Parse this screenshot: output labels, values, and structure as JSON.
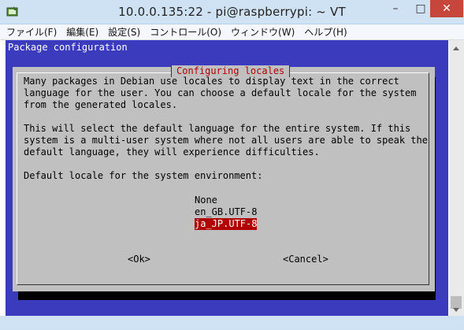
{
  "window": {
    "title": "10.0.0.135:22 - pi@raspberrypi: ~ VT",
    "minimize_icon": "minimize-icon",
    "maximize_icon": "maximize-icon",
    "close_icon": "close-icon"
  },
  "menu": {
    "items": [
      {
        "label": "ファイル(F)"
      },
      {
        "label": "編集(E)"
      },
      {
        "label": "設定(S)"
      },
      {
        "label": "コントロール(O)"
      },
      {
        "label": "ウィンドウ(W)"
      },
      {
        "label": "ヘルプ(H)"
      }
    ]
  },
  "terminal": {
    "header": "Package configuration",
    "dialog": {
      "title": "Configuring locales",
      "description": "Many packages in Debian use locales to display text in the correct\nlanguage for the user. You can choose a default locale for the system\nfrom the generated locales.\n\nThis will select the default language for the entire system. If this\nsystem is a multi-user system where not all users are able to speak the\ndefault language, they will experience difficulties.\n\nDefault locale for the system environment:",
      "options": [
        "None",
        "en_GB.UTF-8",
        "ja_JP.UTF-8"
      ],
      "selected": "ja_JP.UTF-8",
      "ok_label": "<Ok>",
      "cancel_label": "<Cancel>"
    }
  },
  "colors": {
    "terminal_bg": "#3b3bbd",
    "dialog_bg": "#c0c0c0",
    "title_red": "#b00000",
    "selection_bg": "#b00000"
  }
}
